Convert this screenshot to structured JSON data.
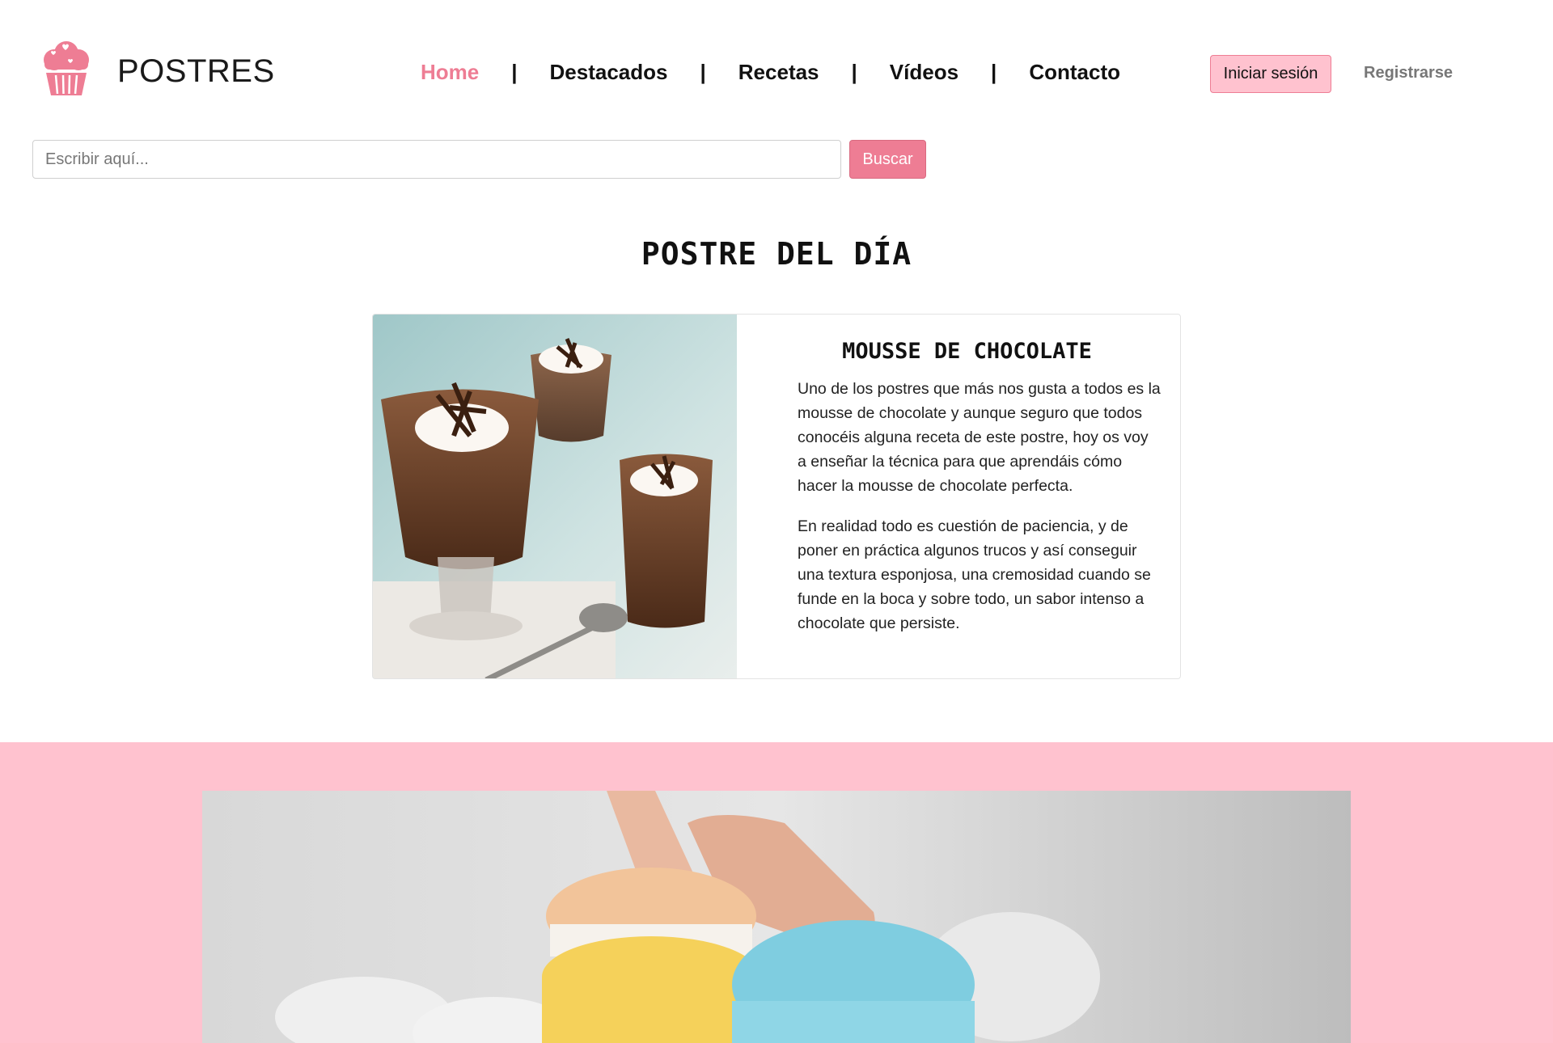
{
  "brand": {
    "name": "POSTRES",
    "logo_icon": "cupcake-icon",
    "accent_color": "#ee7d94",
    "pink_color": "#ffc2cf"
  },
  "nav": {
    "items": [
      "Home",
      "Destacados",
      "Recetas",
      "Vídeos",
      "Contacto"
    ],
    "separator": "|",
    "active": "Home"
  },
  "auth": {
    "login_label": "Iniciar sesión",
    "register_label": "Registrarse"
  },
  "search": {
    "placeholder": "Escribir aquí...",
    "button_label": "Buscar"
  },
  "featured": {
    "section_title": "POSTRE DEL DÍA",
    "title": "MOUSSE DE CHOCOLATE",
    "paragraphs": [
      "Uno de los postres que más nos gusta a todos es la mousse de chocolate y aunque seguro que todos conocéis alguna receta de este postre, hoy os voy a enseñar la técnica para que aprendáis cómo hacer la mousse de chocolate perfecta.",
      "En realidad todo es cuestión de paciencia, y de poner en práctica algunos trucos y así conseguir una textura esponjosa, una cremosidad cuando se funde en la boca y sobre todo, un sabor intenso a chocolate que persiste."
    ]
  }
}
